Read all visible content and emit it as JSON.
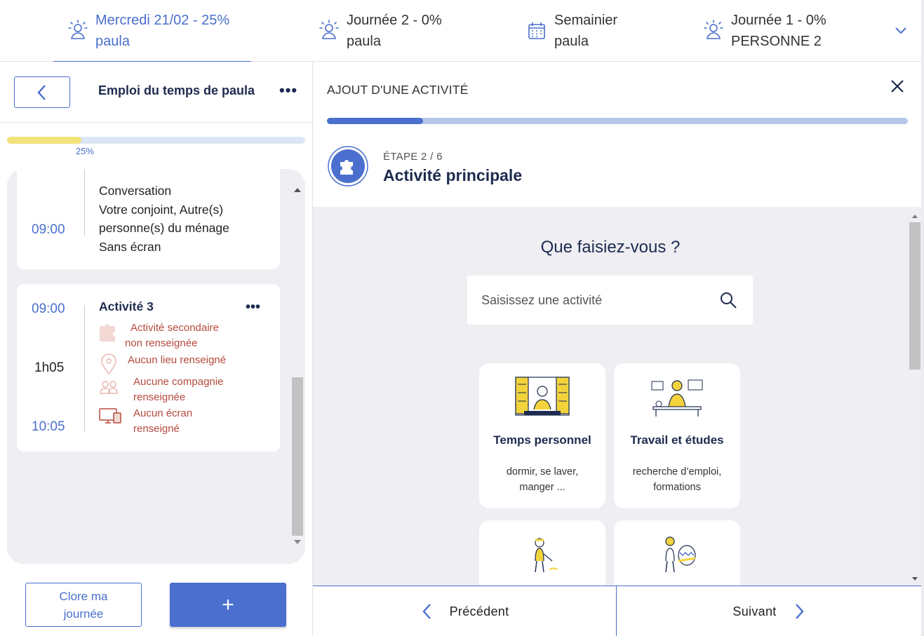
{
  "tabs": [
    {
      "line1": "Mercredi 21/02 - 25%",
      "line2": "paula",
      "icon": "sunrise-person-icon",
      "active": true
    },
    {
      "line1": "Journée 2 - 0%",
      "line2": "paula",
      "icon": "sunrise-person-icon",
      "active": false
    },
    {
      "line1": "Semainier",
      "line2": "paula",
      "icon": "calendar-icon",
      "active": false
    },
    {
      "line1": "Journée 1 - 0%",
      "line2": "PERSONNE 2",
      "icon": "sunrise-person-icon",
      "active": false
    }
  ],
  "colors": {
    "accent": "#4a6fce",
    "progress_yellow": "#f2e27a",
    "warning": "#b5493e",
    "navy": "#1d2b4f"
  },
  "left": {
    "title": "Emploi du temps de paula",
    "progress": {
      "value": 0.25,
      "label": "25%"
    },
    "card1": {
      "lines": [
        "Conversation",
        "Votre conjoint, Autre(s)",
        "personne(s) du ménage",
        "Sans écran"
      ],
      "time_end": "09:00"
    },
    "card2": {
      "title": "Activité 3",
      "time_start": "09:00",
      "duration": "1h05",
      "time_end": "10:05",
      "warnings": [
        {
          "icon": "puzzle-icon",
          "line1": "Activité secondaire",
          "line2": "non renseignée"
        },
        {
          "icon": "location-pin-icon",
          "line1": "Aucun lieu renseigné",
          "line2": ""
        },
        {
          "icon": "people-icon",
          "line1": "Aucune compagnie",
          "line2": "renseignée"
        },
        {
          "icon": "screen-icon",
          "line1": "Aucun écran",
          "line2": "renseigné"
        }
      ]
    },
    "close_day": {
      "line1": "Clore ma",
      "line2": "journée"
    },
    "add_label": "+"
  },
  "right": {
    "title": "AJOUT D'UNE ACTIVITÉ",
    "step_progress": 0.166,
    "step_label": "ÉTAPE 2 / 6",
    "step_name": "Activité principale",
    "question": "Que faisiez-vous ?",
    "search": {
      "placeholder": "Saisissez une activité",
      "value": ""
    },
    "tiles": [
      {
        "name": "Temps personnel",
        "sub1": "dormir, se laver,",
        "sub2": "manger ..."
      },
      {
        "name": "Travail et études",
        "sub1": "recherche d’emploi,",
        "sub2": "formations"
      },
      {
        "name": "",
        "sub1": "",
        "sub2": ""
      },
      {
        "name": "",
        "sub1": "",
        "sub2": ""
      }
    ],
    "prev_label": "Précédent",
    "next_label": "Suivant"
  }
}
